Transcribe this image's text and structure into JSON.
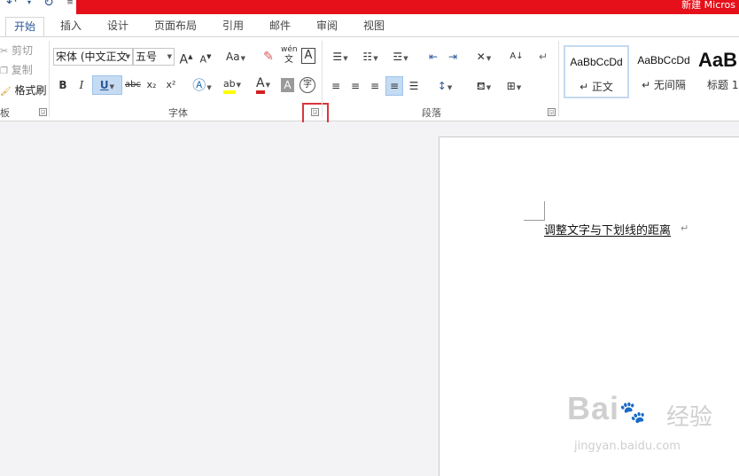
{
  "titlebar": {
    "title": "新建 Micros",
    "undo_icon": "undo-icon",
    "redo_icon": "redo-icon",
    "customize_icon": "customize-qat-icon"
  },
  "tabs": [
    {
      "label": "开始",
      "active": true
    },
    {
      "label": "插入"
    },
    {
      "label": "设计"
    },
    {
      "label": "页面布局"
    },
    {
      "label": "引用"
    },
    {
      "label": "邮件"
    },
    {
      "label": "审阅"
    },
    {
      "label": "视图"
    }
  ],
  "clipboard": {
    "cut": "剪切",
    "copy": "复制",
    "format_painter": "格式刷",
    "group_label": "板"
  },
  "font": {
    "font_name": "宋体 (中文正文",
    "font_size": "五号",
    "group_label": "字体",
    "bold": "B",
    "italic": "I",
    "underline": "U",
    "strikethrough": "abc",
    "subscript": "x₂",
    "superscript": "x²",
    "change_case": "Aa",
    "grow": "A",
    "shrink": "A",
    "phonetic_top": "wén",
    "phonetic_bottom": "文",
    "border_char": "A",
    "font_color_letter": "A",
    "shading_letter": "A",
    "enclose_char": "字",
    "highlight_label": "ab"
  },
  "paragraph": {
    "group_label": "段落"
  },
  "styles": [
    {
      "sample": "AaBbCcDd",
      "name": "↵ 正文",
      "selected": true
    },
    {
      "sample": "AaBbCcDd",
      "name": "↵ 无间隔"
    },
    {
      "sample": "AaB",
      "name": "标题 1"
    }
  ],
  "document": {
    "text": "调整文字与下划线的距离",
    "paragraph_mark": "↵"
  },
  "watermark": {
    "main": "Bai",
    "du": "du",
    "sub": "经验",
    "url": "jingyan.baidu.com"
  },
  "colors": {
    "title_red": "#e5101a",
    "accent": "#2b579a",
    "highlight_yellow": "#ffff00",
    "font_red": "#d22020",
    "annotation_box": "#d9363e"
  }
}
